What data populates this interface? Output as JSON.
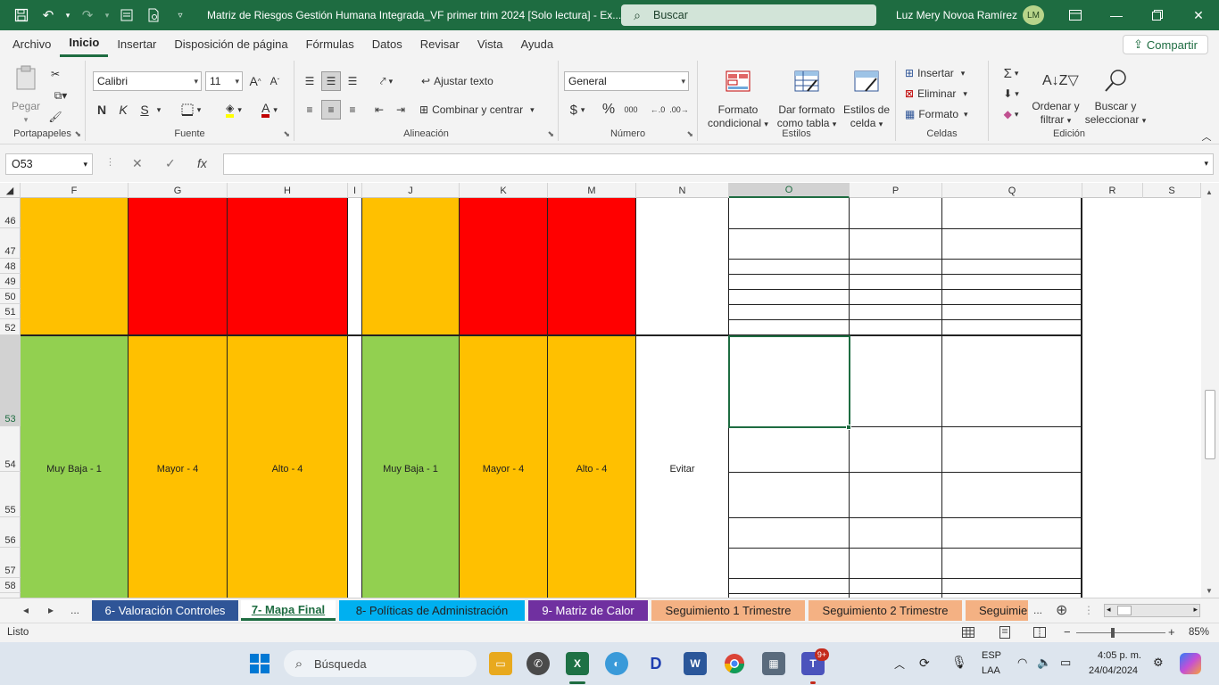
{
  "titlebar": {
    "title": "Matriz de Riesgos Gestión Humana Integrada_VF primer trim 2024  [Solo lectura]  -  Ex...",
    "search_placeholder": "Buscar",
    "user_name": "Luz Mery Novoa Ramírez",
    "user_initials": "LM"
  },
  "ribbon_tabs": [
    "Archivo",
    "Inicio",
    "Insertar",
    "Disposición de página",
    "Fórmulas",
    "Datos",
    "Revisar",
    "Vista",
    "Ayuda"
  ],
  "active_tab": "Inicio",
  "share_label": "Compartir",
  "ribbon": {
    "clipboard": {
      "paste": "Pegar",
      "label": "Portapapeles"
    },
    "font": {
      "name": "Calibri",
      "size": "11",
      "bold": "N",
      "italic": "K",
      "underline": "S",
      "label": "Fuente"
    },
    "alignment": {
      "wrap": "Ajustar texto",
      "merge": "Combinar y centrar",
      "label": "Alineación"
    },
    "number": {
      "format": "General",
      "currency": "$",
      "percent": "%",
      "thousands": "000",
      "label": "Número"
    },
    "styles": {
      "conditional_1": "Formato",
      "conditional_2": "condicional",
      "table_1": "Dar formato",
      "table_2": "como tabla",
      "cell_1": "Estilos de",
      "cell_2": "celda",
      "label": "Estilos"
    },
    "cells": {
      "insert": "Insertar",
      "delete": "Eliminar",
      "format": "Formato",
      "label": "Celdas"
    },
    "editing": {
      "sort_1": "Ordenar y",
      "sort_2": "filtrar",
      "find_1": "Buscar y",
      "find_2": "seleccionar",
      "label": "Edición"
    }
  },
  "formula_bar": {
    "name_box": "O53",
    "fx": "fx",
    "formula": ""
  },
  "grid": {
    "columns": [
      "F",
      "G",
      "H",
      "I",
      "J",
      "K",
      "M",
      "N",
      "O",
      "P",
      "Q",
      "R",
      "S"
    ],
    "selected_column": "O",
    "rows": [
      "46",
      "47",
      "48",
      "49",
      "50",
      "51",
      "52",
      "53",
      "54",
      "55",
      "56",
      "57",
      "58"
    ],
    "selected_row": "53",
    "cells": {
      "F": "Muy Baja - 1",
      "G": "Mayor - 4",
      "H": "Alto  - 4",
      "J": "Muy Baja - 1",
      "K": "Mayor - 4",
      "M": "Alto  - 4",
      "N": "Evitar"
    },
    "colors": {
      "orange": "#ffc000",
      "red": "#ff0000",
      "green": "#92d050"
    }
  },
  "sheet_tabs": [
    {
      "label": "6- Valoración Controles",
      "color": "#2f5597"
    },
    {
      "label": "7- Mapa Final",
      "color": "#ffffff"
    },
    {
      "label": "8- Políticas de Administración",
      "color": "#00b0f0"
    },
    {
      "label": "9- Matriz de Calor",
      "color": "#7030a0"
    },
    {
      "label": "Seguimiento 1 Trimestre",
      "color": "#f4b183"
    },
    {
      "label": "Seguimiento 2 Trimestre",
      "color": "#f4b183"
    },
    {
      "label": "Seguimie",
      "color": "#f4b183"
    }
  ],
  "sheet_ellipsis": "...",
  "status": {
    "ready": "Listo",
    "zoom": "85%"
  },
  "taskbar": {
    "search_placeholder": "Búsqueda",
    "lang_1": "ESP",
    "lang_2": "LAA",
    "time": "4:05 p. m.",
    "date": "24/04/2024",
    "teams_badge": "9+"
  }
}
